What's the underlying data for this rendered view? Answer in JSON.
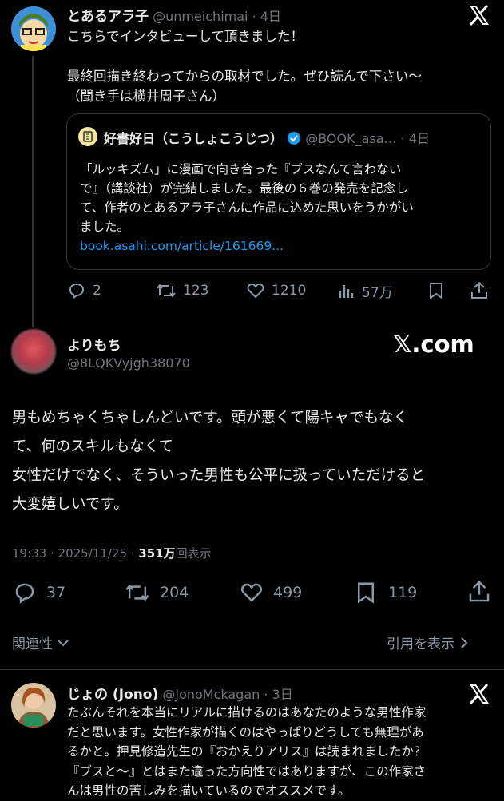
{
  "tweet1": {
    "name": "とあるアラ子",
    "handle": "@unmeichimai",
    "time": "· 4日",
    "line1": "こちらでインタビューして頂きました！",
    "line2": "最終回描き終わってからの取材でした。ぜひ読んで下さい〜",
    "line3": "（聞き手は横井周子さん）",
    "quote": {
      "name": "好書好日（こうしょこうじつ）",
      "handle": "@BOOK_asa…",
      "time": "· 4日",
      "lines": [
        "「ルッキズム」に漫画で向き合った『ブスなんて言わない",
        "で』（講談社）が完結しました。最後の６巻の発売を記念し",
        "て、作者のとあるアラ子さんに作品に込めた思いをうかがい",
        "ました。"
      ],
      "link": "book.asahi.com/article/161669..."
    },
    "replies": "2",
    "reposts": "123",
    "likes": "1210",
    "views": "57万"
  },
  "tweet2": {
    "name": "よりもち",
    "handle": "@8LQKVyjgh38070",
    "watermark": "𝕏.com",
    "lines": [
      "男もめちゃくちゃしんどいです。頭が悪くて陽キャでもなく",
      "て、何のスキルもなくて",
      "女性だけでなく、そういった男性も公平に扱っていただけると",
      "大変嬉しいです。"
    ],
    "time": "19:33 · 2025/11/25 · ",
    "views_count": "351万",
    "views_label": "回表示",
    "replies": "37",
    "reposts": "204",
    "likes": "499",
    "bookmarks": "119",
    "related": "関連性",
    "quotes": "引用を表示"
  },
  "tweet3": {
    "name": "じょの (Jono)",
    "handle": "@JonoMckagan",
    "time": "· 3日",
    "lines": [
      "たぶんそれを本当にリアルに描けるのはあなたのような男性作家",
      "だと思います。女性作家が描くのはやっぱりどうしても無理があ",
      "るかと。押見修造先生の『おかえりアリス』は読まれましたか？",
      "『ブスと〜』とはまた違った方向性ではありますが、この作家さ",
      "んは男性の苦しみを描いているのでオススメです。"
    ]
  }
}
